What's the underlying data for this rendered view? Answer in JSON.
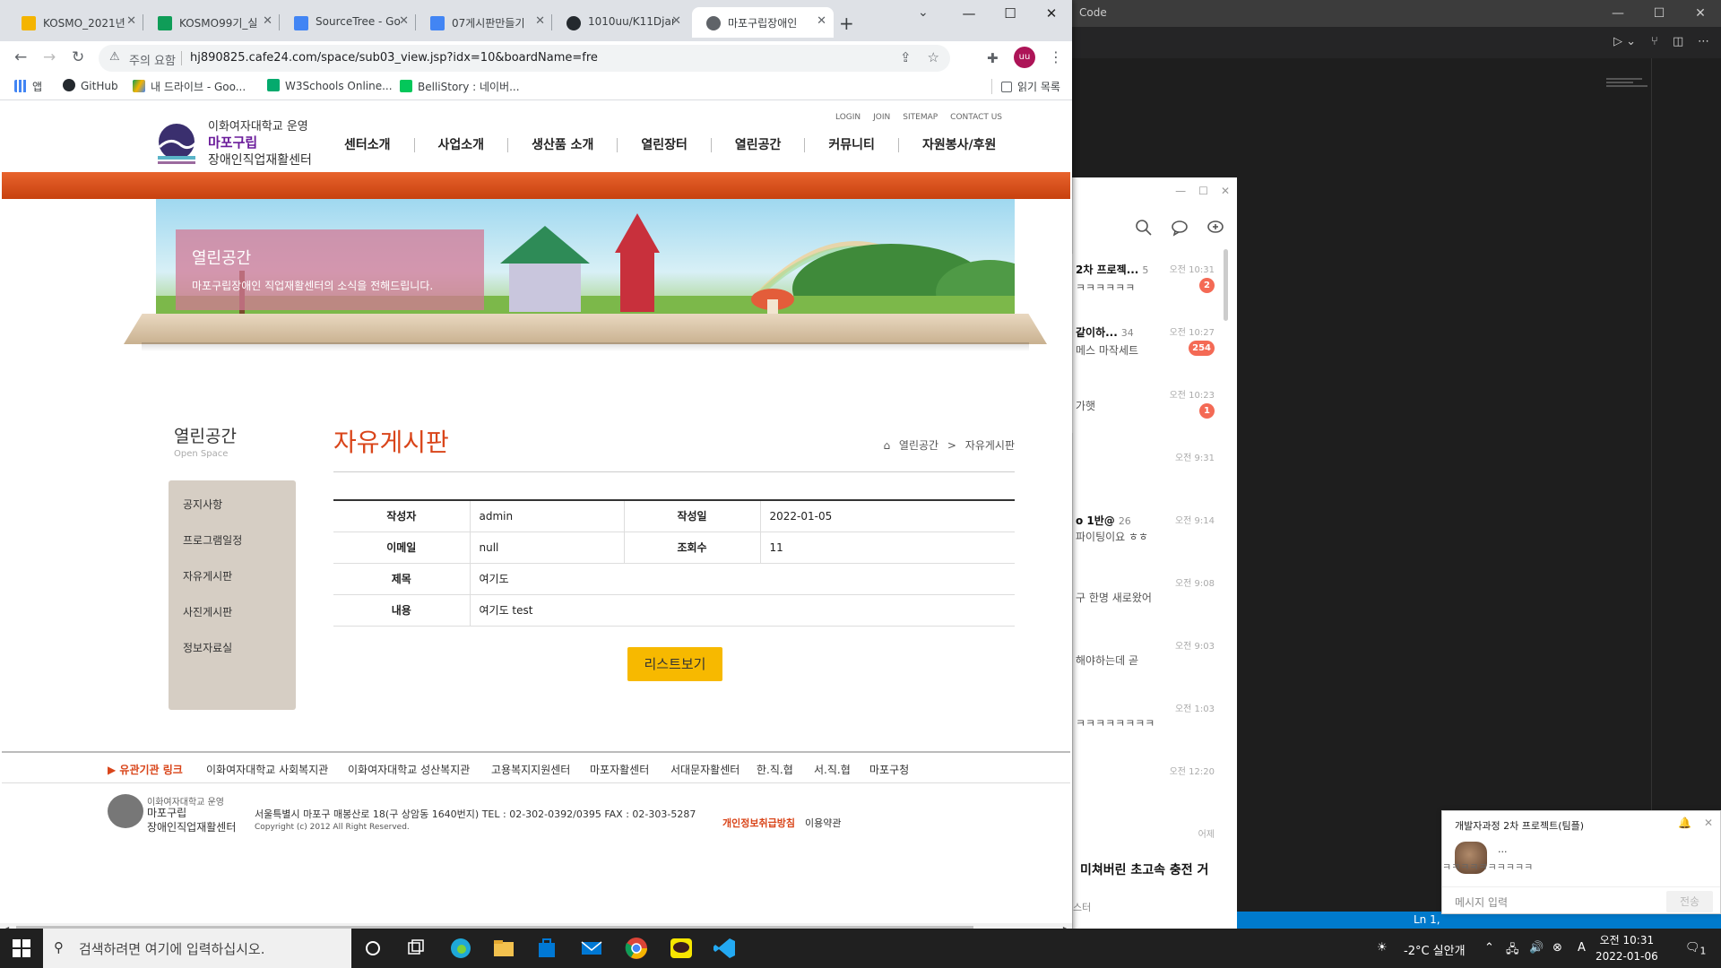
{
  "vscode": {
    "title_partial": "Code",
    "status_partial": "Ln 1,"
  },
  "kakao": {
    "chats": [
      {
        "name": "2차 프로젝...",
        "count": "5",
        "time": "오전 10:31",
        "msg": "ㅋㅋㅋㅋㅋㅋ",
        "badge": "2"
      },
      {
        "name": "같이하...",
        "count": "34",
        "time": "오전 10:27",
        "msg": "메스 마작세트",
        "badge": "254"
      },
      {
        "name": "",
        "count": "",
        "time": "오전 10:23",
        "msg": "가햇",
        "badge": "1"
      },
      {
        "name": "",
        "count": "",
        "time": "오전 9:31",
        "msg": "",
        "badge": ""
      },
      {
        "name": "o 1반@",
        "count": "26",
        "time": "오전 9:14",
        "msg": "파이팅이요 ㅎㅎ",
        "badge": ""
      },
      {
        "name": "",
        "count": "",
        "time": "오전 9:08",
        "msg": "구 한명 새로왔어",
        "badge": ""
      },
      {
        "name": "",
        "count": "",
        "time": "오전 9:03",
        "msg": "해야하는데 곧",
        "badge": ""
      },
      {
        "name": "",
        "count": "",
        "time": "오전 1:03",
        "msg": "ㅋㅋㅋㅋㅋㅋㅋㅋ",
        "badge": ""
      },
      {
        "name": "",
        "count": "",
        "time": "오전 12:20",
        "msg": "",
        "badge": ""
      }
    ],
    "yesterday": "어제",
    "banner": "미쳐버린 초고속 충전 거",
    "banner_sub": "스터"
  },
  "kpopup": {
    "title": "개발자과정 2차 프로젝트(팀플)",
    "sender": "...",
    "message": "ㅋㅋㅋㅋㅋㅋㅋㅋㅋㅋ",
    "input_placeholder": "메시지 입력",
    "send": "전송"
  },
  "tabs": [
    {
      "title": "KOSMO_2021년",
      "color": "#f4b400"
    },
    {
      "title": "KOSMO99기_실",
      "color": "#0f9d58"
    },
    {
      "title": "SourceTree - Go",
      "color": "#4285f4"
    },
    {
      "title": "07게시판만들기",
      "color": "#4285f4"
    },
    {
      "title": "1010uu/K11Djan",
      "color": "#24292e"
    },
    {
      "title": "마포구립장애인",
      "color": "#5f6368"
    }
  ],
  "omnibox": {
    "security": "주의 요함",
    "url": "hj890825.cafe24.com/space/sub03_view.jsp?idx=10&boardName=fre"
  },
  "profile": "uu",
  "bookmarks": {
    "apps": "앱",
    "items": [
      "GitHub",
      "내 드라이브 - Goo...",
      "W3Schools Online...",
      "BelliStory : 네이버..."
    ],
    "reading_list": "읽기 목록"
  },
  "site": {
    "logo": {
      "org": "이화여자대학교 운영",
      "name": "마포구립",
      "center": "장애인직업재활센터"
    },
    "util": [
      "LOGIN",
      "JOIN",
      "SITEMAP",
      "CONTACT US"
    ],
    "gnb": [
      "센터소개",
      "사업소개",
      "생산품 소개",
      "열린장터",
      "열린공간",
      "커뮤니티",
      "자원봉사/후원"
    ],
    "banner": {
      "title": "열린공간",
      "subtitle": "마포구립장애인 직업재활센터의 소식을 전해드립니다."
    },
    "lnb": {
      "title": "열린공간",
      "subtitle": "Open Space",
      "items": [
        "공지사항",
        "프로그램일정",
        "자유게시판",
        "사진게시판",
        "정보자료실"
      ]
    },
    "page_title": "자유게시판",
    "breadcrumb": [
      "열린공간",
      "자유게시판"
    ],
    "post": {
      "writer_label": "작성자",
      "writer": "admin",
      "date_label": "작성일",
      "date": "2022-01-05",
      "email_label": "이메일",
      "email": "null",
      "views_label": "조회수",
      "views": "11",
      "subject_label": "제목",
      "subject": "여기도",
      "content_label": "내용",
      "content": "여기도 test"
    },
    "list_button": "리스트보기",
    "footer_links": [
      "유관기관 링크",
      "이화여자대학교 사회복지관",
      "이화여자대학교 성산복지관",
      "고용복지지원센터",
      "마포자활센터",
      "서대문자활센터",
      "한.직.협",
      "서.직.협",
      "마포구청"
    ],
    "footer": {
      "address": "서울특별시 마포구 매봉산로 18(구 상암동 1640번지)   TEL : 02-302-0392/0395    FAX : 02-303-5287",
      "copyright": "Copyright (c) 2012 All Right Reserved.",
      "privacy": "개인정보취급방침",
      "terms": "이용약관"
    }
  },
  "taskbar": {
    "search_placeholder": "검색하려면 여기에 입력하십시오.",
    "weather": "-2°C  실안개",
    "ime": "A",
    "time": "오전 10:31",
    "date": "2022-01-06",
    "notif_count": "1"
  }
}
